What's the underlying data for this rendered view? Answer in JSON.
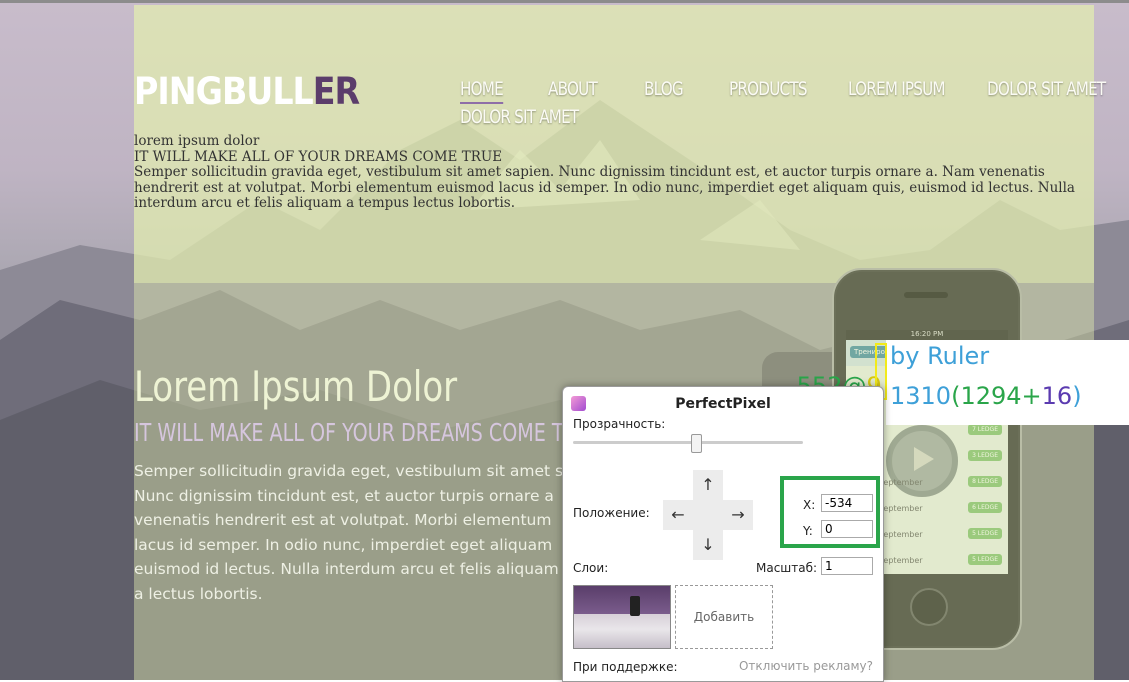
{
  "site": {
    "logo_main": "PINGBULL",
    "logo_accent": "ER",
    "nav": [
      "HOME",
      "ABOUT",
      "BLOG",
      "PRODUCTS",
      "LOREM IPSUM",
      "DOLOR SIT AMET",
      "DOLOR SIT AMET"
    ],
    "underlay_line1": "lorem ipsum dolor",
    "underlay_line2": "IT WILL MAKE ALL OF YOUR DREAMS COME TRUE",
    "underlay_paragraph": "Semper sollicitudin gravida eget, vestibulum sit amet sapien. Nunc dignissim tincidunt est, et auctor turpis ornare a. Nam venenatis hendrerit est at volutpat. Morbi elementum euismod lacus id semper. In odio nunc, imperdiet eget aliquam quis, euismod id lectus. Nulla interdum arcu et felis aliquam a tempus lectus lobortis.",
    "hero_title": "Lorem Ipsum Dolor",
    "hero_subtitle": "IT WILL MAKE ALL OF YOUR DREAMS COME TRUE",
    "hero_body": "Semper sollicitudin gravida eget, vestibulum sit amet s Nunc dignissim tincidunt est, et auctor turpis ornare a venenatis hendrerit est at volutpat. Morbi elementum lacus id semper. In odio nunc, imperdiet eget aliquam euismod id lectus. Nulla interdum arcu et felis aliquam a lectus lobortis."
  },
  "phone": {
    "time": "16:20 PM",
    "app_tab": "Тренировки",
    "rows": [
      {
        "label": "",
        "tag": "7 LEDGE"
      },
      {
        "label": "",
        "tag": "3 LEDGE"
      },
      {
        "label": "15. september",
        "tag": "8 LEDGE"
      },
      {
        "label": "16. september",
        "tag": "6 LEDGE"
      },
      {
        "label": "17. september",
        "tag": "5 LEDGE"
      },
      {
        "label": "18. september",
        "tag": "5 LEDGE"
      }
    ]
  },
  "annotation": {
    "ruler_line1": "by Ruler",
    "ruler_total": "1310",
    "ruler_open": "(",
    "ruler_a": "1294",
    "ruler_plus": "+",
    "ruler_b": "16",
    "ruler_close": ")",
    "green_value": "-552@",
    "green_tail": "9"
  },
  "perfectpixel": {
    "title": "PerfectPixel",
    "opacity_label": "Прозрачность:",
    "position_label": "Положение:",
    "arrow_up": "↑",
    "arrow_down": "↓",
    "arrow_left": "←",
    "arrow_right": "→",
    "x_label": "X:",
    "x_value": "-534",
    "y_label": "Y:",
    "y_value": "0",
    "layers_label": "Слои:",
    "scale_label": "Масштаб:",
    "scale_value": "1",
    "add_label": "Добавить",
    "support_label": "При поддержке:",
    "disable_ads": "Отключить рекламу?"
  }
}
